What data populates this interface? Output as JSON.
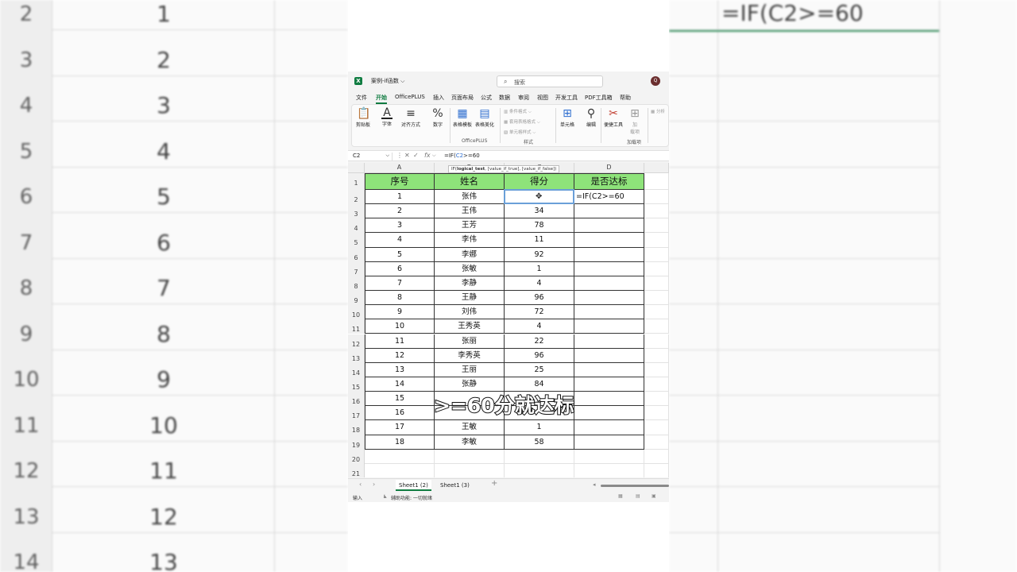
{
  "background": {
    "left_rows": [
      {
        "num": "2",
        "val": "1"
      },
      {
        "num": "3",
        "val": "2"
      },
      {
        "num": "4",
        "val": "3"
      },
      {
        "num": "5",
        "val": "4"
      },
      {
        "num": "6",
        "val": "5"
      },
      {
        "num": "7",
        "val": "6"
      },
      {
        "num": "8",
        "val": "7"
      },
      {
        "num": "9",
        "val": "8"
      },
      {
        "num": "10",
        "val": "9"
      },
      {
        "num": "11",
        "val": "10"
      },
      {
        "num": "12",
        "val": "11"
      },
      {
        "num": "13",
        "val": "12"
      },
      {
        "num": "14",
        "val": "13"
      }
    ],
    "right_formula": "=IF(C2>=60"
  },
  "title_bar": {
    "app_icon": "excel-icon",
    "doc_title": "案例-if函数 ⌵",
    "search_placeholder": "搜索",
    "avatar_letter": "Q"
  },
  "ribbon_tabs": [
    "文件",
    "开始",
    "OfficePLUS",
    "插入",
    "页面布局",
    "公式",
    "数据",
    "审阅",
    "视图",
    "开发工具",
    "PDF工具箱",
    "帮助"
  ],
  "active_tab": "开始",
  "ribbon": {
    "clipboard": "剪贴板",
    "font": "字体",
    "align": "对齐方式",
    "number": "数字",
    "table_template": "表格模板",
    "table_beautify": "表格美化",
    "officeplus_group": "OfficePLUS",
    "cond_format": "条件格式 ⌵",
    "table_format": "套用表格格式 ⌵",
    "cell_style": "单元格样式 ⌵",
    "style_group": "样式",
    "cells": "单元格",
    "edit": "编辑",
    "tools": "便捷工具",
    "addins_line1": "加",
    "addins_line2": "载项",
    "addins_group": "加载项",
    "cut_label": "分析"
  },
  "formula_bar": {
    "name_box": "C2",
    "cancel": "✕",
    "confirm": "✓",
    "fx": "fx",
    "formula_prefix": "=IF(",
    "formula_ref": "C2",
    "formula_suffix": ">=60"
  },
  "tooltip": {
    "fn": "IF(",
    "arg1": "logical_test",
    "rest": ", [value_if_true], [value_if_false])"
  },
  "columns": [
    "A",
    "B",
    "C",
    "D"
  ],
  "header_row": [
    "序号",
    "姓名",
    "得分",
    "是否达标"
  ],
  "rows": [
    {
      "n": "1",
      "name": "张伟",
      "score": "",
      "result": "=IF(C2>=60"
    },
    {
      "n": "2",
      "name": "王伟",
      "score": "34",
      "result": ""
    },
    {
      "n": "3",
      "name": "王芳",
      "score": "78",
      "result": ""
    },
    {
      "n": "4",
      "name": "李伟",
      "score": "11",
      "result": ""
    },
    {
      "n": "5",
      "name": "李娜",
      "score": "92",
      "result": ""
    },
    {
      "n": "6",
      "name": "张敏",
      "score": "1",
      "result": ""
    },
    {
      "n": "7",
      "name": "李静",
      "score": "4",
      "result": ""
    },
    {
      "n": "8",
      "name": "王静",
      "score": "96",
      "result": ""
    },
    {
      "n": "9",
      "name": "刘伟",
      "score": "72",
      "result": ""
    },
    {
      "n": "10",
      "name": "王秀英",
      "score": "4",
      "result": ""
    },
    {
      "n": "11",
      "name": "张丽",
      "score": "22",
      "result": ""
    },
    {
      "n": "12",
      "name": "李秀英",
      "score": "96",
      "result": ""
    },
    {
      "n": "13",
      "name": "王丽",
      "score": "25",
      "result": ""
    },
    {
      "n": "14",
      "name": "张静",
      "score": "84",
      "result": ""
    },
    {
      "n": "15",
      "name": "",
      "score": "",
      "result": ""
    },
    {
      "n": "16",
      "name": "",
      "score": "",
      "result": ""
    },
    {
      "n": "17",
      "name": "王敏",
      "score": "1",
      "result": ""
    },
    {
      "n": "18",
      "name": "李敏",
      "score": "58",
      "result": ""
    }
  ],
  "row_numbers": [
    "1",
    "2",
    "3",
    "4",
    "5",
    "6",
    "7",
    "8",
    "9",
    "10",
    "11",
    "12",
    "13",
    "14",
    "15",
    "16",
    "17",
    "18",
    "19",
    "20",
    "21"
  ],
  "sheets": [
    "Sheet1 (2)",
    "Sheet1 (3)"
  ],
  "active_sheet": "Sheet1 (2)",
  "add_sheet": "+",
  "status": {
    "mode": "输入",
    "accessibility": "辅助功能: 一切就绪"
  },
  "caption": ">=60分就达标"
}
